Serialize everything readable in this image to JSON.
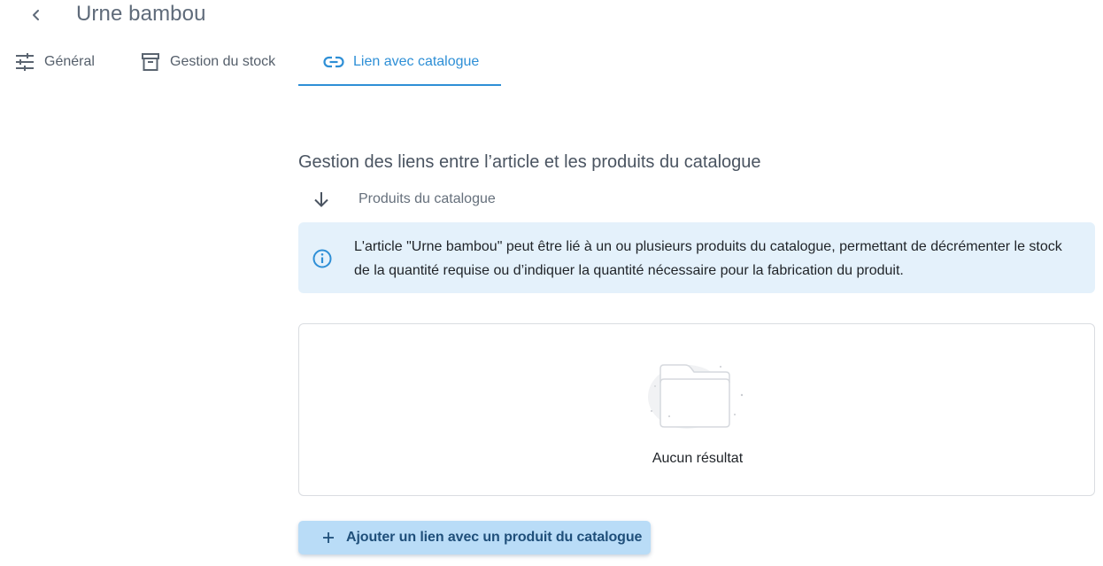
{
  "header": {
    "title": "Urne bambou",
    "back_icon": "chevron-left-icon"
  },
  "tabs": [
    {
      "label": "Général",
      "icon": "tune-icon",
      "active": false
    },
    {
      "label": "Gestion du stock",
      "icon": "archive-icon",
      "active": false
    },
    {
      "label": "Lien avec catalogue",
      "icon": "link-icon",
      "active": true
    }
  ],
  "section": {
    "title": "Gestion des liens entre l’article et les produits du catalogue",
    "sub_label": "Produits du catalogue",
    "sub_icon": "arrow-down-icon"
  },
  "info": {
    "icon": "info-icon",
    "text": "L'article \"Urne bambou\" peut être lié à un ou plusieurs produits du catalogue, permettant de décrémenter le stock de la quantité requise ou d’indiquer la quantité nécessaire pour la fabrication du produit."
  },
  "empty_state": {
    "icon": "empty-folder-icon",
    "text": "Aucun résultat"
  },
  "add_button": {
    "label": "Ajouter un lien avec un produit du catalogue",
    "icon": "plus-icon"
  },
  "colors": {
    "accent": "#2e8fd6",
    "info_background": "#e4f1fb",
    "button_background": "#b9dcf7",
    "button_text": "#1f4f7a"
  }
}
